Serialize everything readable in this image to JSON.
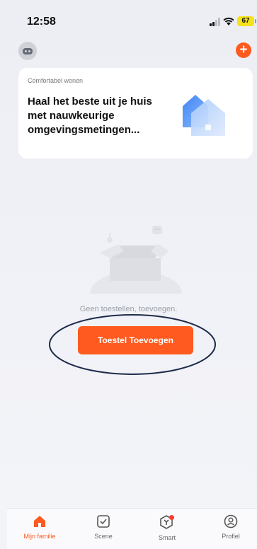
{
  "status_bar": {
    "time": "12:58",
    "battery": "67"
  },
  "header": {
    "home_icon": "home-switch-icon",
    "add_icon": "plus-icon"
  },
  "banner": {
    "label": "Comfortabel wonen",
    "title": "Haal het beste uit je huis met nauwkeurige omgevingsmetingen..."
  },
  "empty_state": {
    "message": "Geen toestellen, toevoegen.",
    "button_label": "Toestel Toevoegen"
  },
  "tabs": [
    {
      "label": "Mijn familie",
      "icon": "home-icon",
      "active": true
    },
    {
      "label": "Scene",
      "icon": "checkbox-icon",
      "active": false
    },
    {
      "label": "Smart",
      "icon": "smart-icon",
      "active": false,
      "badge": true
    },
    {
      "label": "Profiel",
      "icon": "profile-icon",
      "active": false
    }
  ],
  "colors": {
    "accent": "#ff5a1f",
    "annotation": "#1c2a4a"
  }
}
